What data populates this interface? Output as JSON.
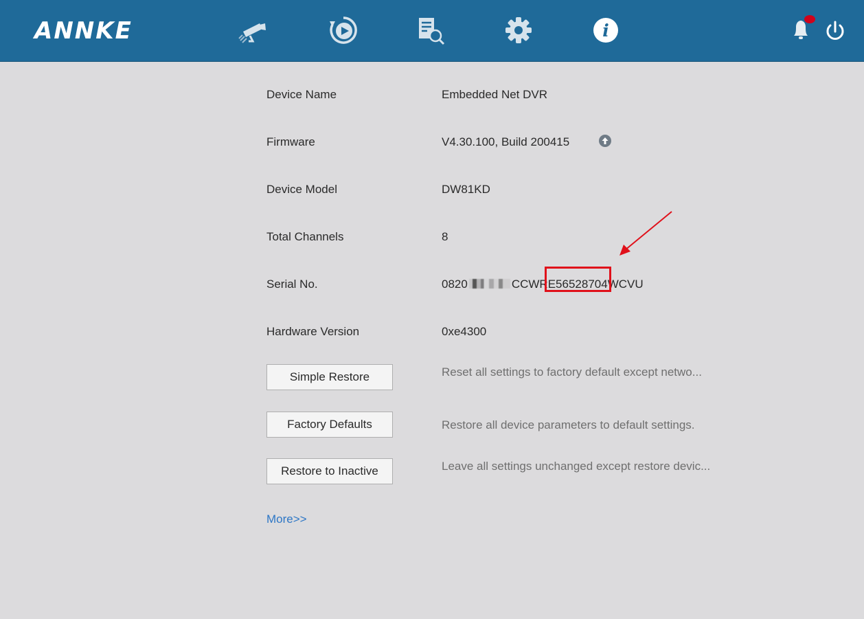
{
  "header": {
    "logo": "ANNKE",
    "nav": [
      {
        "name": "camera-icon"
      },
      {
        "name": "playback-icon"
      },
      {
        "name": "search-log-icon"
      },
      {
        "name": "settings-gear-icon"
      },
      {
        "name": "info-icon",
        "active": true
      }
    ],
    "alerts_icon": "bell-icon",
    "alert_badge_color": "#d0021b",
    "power_icon": "power-icon"
  },
  "info": {
    "device_name_label": "Device Name",
    "device_name_value": "Embedded Net DVR",
    "firmware_label": "Firmware",
    "firmware_value": "V4.30.100, Build 200415",
    "device_model_label": "Device Model",
    "device_model_value": "DW81KD",
    "total_channels_label": "Total Channels",
    "total_channels_value": "8",
    "serial_label": "Serial No.",
    "serial_prefix": "0820",
    "serial_middle": "CCWR",
    "serial_highlight": "E56528704",
    "serial_suffix": "WCVU",
    "hardware_label": "Hardware Version",
    "hardware_value": "0xe4300"
  },
  "actions": {
    "simple_restore_label": "Simple Restore",
    "simple_restore_desc": "Reset all settings to factory default except netwo...",
    "factory_defaults_label": "Factory Defaults",
    "factory_defaults_desc": "Restore all device parameters to default settings.",
    "restore_inactive_label": "Restore to Inactive",
    "restore_inactive_desc": "Leave all settings unchanged except restore devic...",
    "more_link": "More>>"
  },
  "colors": {
    "header_bg": "#1f6a99",
    "page_bg": "#dcdbdd",
    "annotation_red": "#e0101a",
    "link_blue": "#2e77c6"
  }
}
